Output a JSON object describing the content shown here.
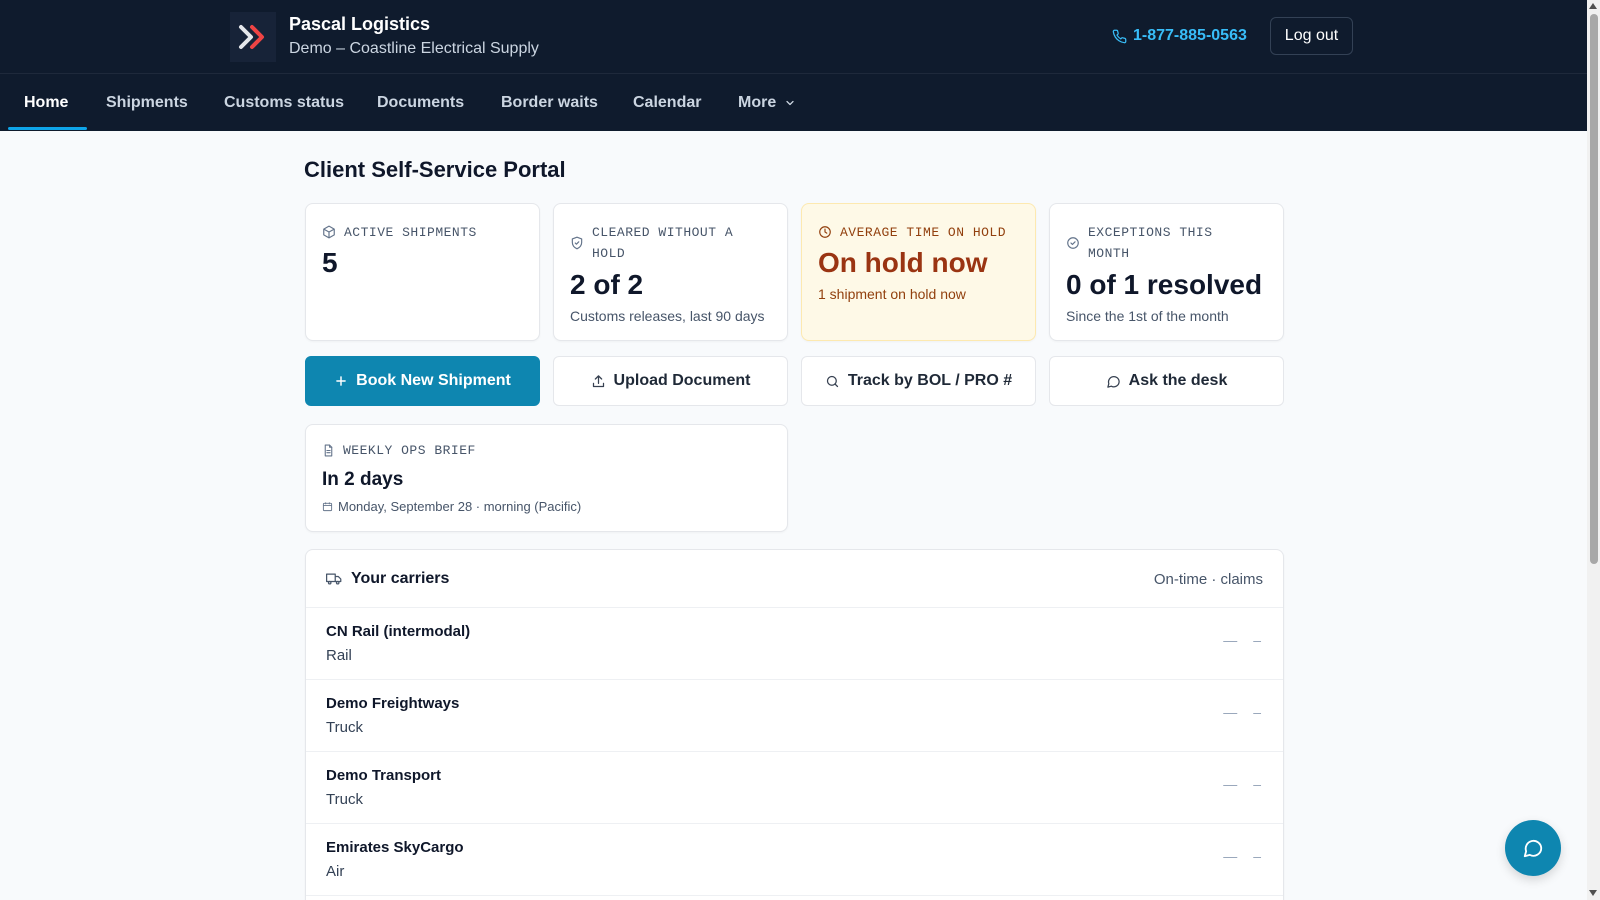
{
  "header": {
    "brand_name": "Pascal Logistics",
    "brand_sub": "Demo – Coastline Electrical Supply",
    "phone": "1-877-885-0563",
    "logout_label": "Log out",
    "logo_icon": "double-chevron-right-icon",
    "accent_color": "#ef4444"
  },
  "nav": {
    "items": [
      {
        "label": "Home"
      },
      {
        "label": "Shipments"
      },
      {
        "label": "Customs status"
      },
      {
        "label": "Documents"
      },
      {
        "label": "Border waits"
      },
      {
        "label": "Calendar"
      },
      {
        "label": "More"
      }
    ],
    "active": "Home"
  },
  "main": {
    "title": "Client Self-Service Portal",
    "stats": [
      {
        "label": "ACTIVE SHIPMENTS",
        "value": "5",
        "caption": "",
        "icon": "package-icon"
      },
      {
        "label": "CLEARED WITHOUT A HOLD",
        "value": "2 of 2",
        "caption": "Customs releases, last 90 days",
        "icon": "shield-check-icon"
      },
      {
        "label": "AVERAGE TIME ON HOLD",
        "value": "On hold now",
        "caption": "1 shipment on hold now",
        "icon": "clock-icon"
      },
      {
        "label": "EXCEPTIONS THIS MONTH",
        "value": "0 of 1 resolved",
        "caption": "Since the 1st of the month",
        "icon": "check-circle-icon"
      }
    ],
    "actions": [
      {
        "label": "Book New Shipment",
        "icon": "plus-icon"
      },
      {
        "label": "Upload Document",
        "icon": "upload-icon"
      },
      {
        "label": "Track by BOL / PRO #",
        "icon": "search-icon"
      },
      {
        "label": "Ask the desk",
        "icon": "message-icon"
      }
    ],
    "brief": {
      "label": "WEEKLY OPS BRIEF",
      "value": "In 2 days",
      "date": "Monday, September 28 · morning (Pacific)"
    },
    "carriers": {
      "title": "Your carriers",
      "meta": "On-time · claims",
      "rows": [
        {
          "name": "CN Rail (intermodal)",
          "mode": "Rail",
          "on_time": "—",
          "claims": "–"
        },
        {
          "name": "Demo Freightways",
          "mode": "Truck",
          "on_time": "—",
          "claims": "–"
        },
        {
          "name": "Demo Transport",
          "mode": "Truck",
          "on_time": "—",
          "claims": "–"
        },
        {
          "name": "Emirates SkyCargo",
          "mode": "Air",
          "on_time": "—",
          "claims": "–"
        }
      ]
    }
  },
  "colors": {
    "header_bg": "#0f1b2d",
    "primary": "#0e86b0",
    "hold_bg": "#fef9e7",
    "hold_text": "#9a3412"
  }
}
